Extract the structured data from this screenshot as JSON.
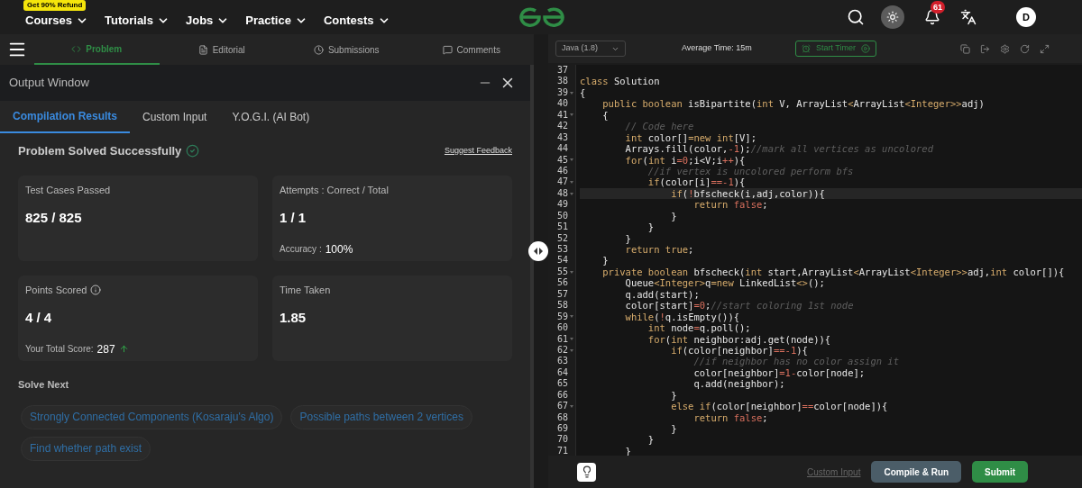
{
  "nav": {
    "promo_badge": "Get 90% Refund",
    "menus": [
      "Courses",
      "Tutorials",
      "Jobs",
      "Practice",
      "Contests"
    ],
    "notification_count": "61",
    "avatar_letter": "D"
  },
  "problem_tabs": [
    {
      "label": "Problem",
      "selected": true
    },
    {
      "label": "Editorial",
      "selected": false
    },
    {
      "label": "Submissions",
      "selected": false
    },
    {
      "label": "Comments",
      "selected": false
    }
  ],
  "output_window": {
    "title": "Output Window",
    "tabs": [
      {
        "label": "Compilation Results",
        "selected": true
      },
      {
        "label": "Custom Input",
        "selected": false
      },
      {
        "label": "Y.O.G.I. (AI Bot)",
        "selected": false
      }
    ],
    "status": "Problem Solved Successfully",
    "feedback_link": "Suggest Feedback",
    "cards": [
      {
        "label": "Test Cases Passed",
        "value": "825 / 825"
      },
      {
        "label": "Attempts : Correct / Total",
        "value": "1 / 1",
        "sub_label": "Accuracy :",
        "sub_value": "100%"
      },
      {
        "label": "Points Scored",
        "info": true,
        "value": "4 / 4",
        "sub_label": "Your Total Score:",
        "sub_value": "287",
        "trend_up": true
      },
      {
        "label": "Time Taken",
        "value": "1.85"
      }
    ],
    "solve_next_title": "Solve Next",
    "solve_next": [
      "Strongly Connected Components (Kosaraju's Algo)",
      "Possible paths between 2 vertices",
      "Find whether path exist"
    ]
  },
  "editor": {
    "language": "Java (1.8)",
    "average_time": "Average Time: 15m",
    "timer_button": "Start Timer",
    "lines": [
      {
        "n": "37"
      },
      {
        "n": "38",
        "code": [
          {
            "kind": "keyword",
            "text": "class"
          },
          {
            "kind": "plain",
            "text": " Solution"
          }
        ]
      },
      {
        "n": "39",
        "fold": true,
        "code": [
          {
            "kind": "plain",
            "text": "{"
          }
        ]
      },
      {
        "n": "40",
        "code": [
          {
            "kind": "keyword",
            "text": "    public boolean"
          },
          {
            "kind": "plain",
            "text": " isBipartite("
          },
          {
            "kind": "keyword",
            "text": "int"
          },
          {
            "kind": "plain",
            "text": " V, ArrayList"
          },
          {
            "kind": "keyword",
            "text": "<"
          },
          {
            "kind": "plain",
            "text": "ArrayList"
          },
          {
            "kind": "keyword",
            "text": "<Integer>>"
          },
          {
            "kind": "plain",
            "text": "adj)"
          }
        ]
      },
      {
        "n": "41",
        "fold": true,
        "code": [
          {
            "kind": "plain",
            "text": "    {"
          }
        ]
      },
      {
        "n": "42",
        "code": [
          {
            "kind": "comment",
            "text": "        // Code here"
          }
        ]
      },
      {
        "n": "43",
        "code": [
          {
            "kind": "keyword",
            "text": "        int"
          },
          {
            "kind": "plain",
            "text": " color[]"
          },
          {
            "kind": "keyword",
            "text": "=new int"
          },
          {
            "kind": "plain",
            "text": "[V];"
          }
        ]
      },
      {
        "n": "44",
        "code": [
          {
            "kind": "plain",
            "text": "        Arrays.fill(color,"
          },
          {
            "kind": "literal",
            "text": "-1"
          },
          {
            "kind": "plain",
            "text": ");"
          },
          {
            "kind": "comment",
            "text": "//mark all vertices as uncolored"
          }
        ]
      },
      {
        "n": "45",
        "fold": true,
        "code": [
          {
            "kind": "keyword",
            "text": "        for"
          },
          {
            "kind": "plain",
            "text": "("
          },
          {
            "kind": "keyword",
            "text": "int"
          },
          {
            "kind": "plain",
            "text": " i"
          },
          {
            "kind": "literal",
            "text": "=0"
          },
          {
            "kind": "plain",
            "text": ";i<V;i"
          },
          {
            "kind": "literal",
            "text": "++"
          },
          {
            "kind": "plain",
            "text": "){"
          }
        ]
      },
      {
        "n": "46",
        "code": [
          {
            "kind": "comment",
            "text": "            //if vertex is uncolored perform bfs"
          }
        ]
      },
      {
        "n": "47",
        "fold": true,
        "code": [
          {
            "kind": "keyword",
            "text": "            if"
          },
          {
            "kind": "plain",
            "text": "(color[i]"
          },
          {
            "kind": "literal",
            "text": "==-1"
          },
          {
            "kind": "plain",
            "text": "){"
          }
        ]
      },
      {
        "n": "48",
        "fold": true,
        "active": true,
        "code": [
          {
            "kind": "keyword",
            "text": "                if"
          },
          {
            "kind": "plain",
            "text": "("
          },
          {
            "kind": "literal",
            "text": "!"
          },
          {
            "kind": "plain",
            "text": "bfscheck(i,adj,color)){"
          }
        ]
      },
      {
        "n": "49",
        "code": [
          {
            "kind": "keyword",
            "text": "                    return"
          },
          {
            "kind": "literal",
            "text": " false"
          },
          {
            "kind": "plain",
            "text": ";"
          }
        ]
      },
      {
        "n": "50",
        "code": [
          {
            "kind": "plain",
            "text": "                }"
          }
        ]
      },
      {
        "n": "51",
        "code": [
          {
            "kind": "plain",
            "text": "            }"
          }
        ]
      },
      {
        "n": "52",
        "code": [
          {
            "kind": "plain",
            "text": "        }"
          }
        ]
      },
      {
        "n": "53",
        "code": [
          {
            "kind": "keyword",
            "text": "        return true"
          },
          {
            "kind": "plain",
            "text": ";"
          }
        ]
      },
      {
        "n": "54",
        "code": [
          {
            "kind": "plain",
            "text": "    }"
          }
        ]
      },
      {
        "n": "55",
        "fold": true,
        "code": [
          {
            "kind": "keyword",
            "text": "    private boolean"
          },
          {
            "kind": "plain",
            "text": " bfscheck("
          },
          {
            "kind": "keyword",
            "text": "int"
          },
          {
            "kind": "plain",
            "text": " start,ArrayList"
          },
          {
            "kind": "keyword",
            "text": "<"
          },
          {
            "kind": "plain",
            "text": "ArrayList"
          },
          {
            "kind": "keyword",
            "text": "<Integer>>"
          },
          {
            "kind": "plain",
            "text": "adj,"
          },
          {
            "kind": "keyword",
            "text": "int"
          },
          {
            "kind": "plain",
            "text": " color[]){"
          }
        ]
      },
      {
        "n": "56",
        "code": [
          {
            "kind": "plain",
            "text": "        Queue"
          },
          {
            "kind": "keyword",
            "text": "<Integer>"
          },
          {
            "kind": "plain",
            "text": "q"
          },
          {
            "kind": "keyword",
            "text": "=new"
          },
          {
            "kind": "plain",
            "text": " LinkedList"
          },
          {
            "kind": "keyword",
            "text": "<>"
          },
          {
            "kind": "plain",
            "text": "();"
          }
        ]
      },
      {
        "n": "57",
        "code": [
          {
            "kind": "plain",
            "text": "        q.add(start);"
          }
        ]
      },
      {
        "n": "58",
        "code": [
          {
            "kind": "plain",
            "text": "        color[start]"
          },
          {
            "kind": "literal",
            "text": "=0"
          },
          {
            "kind": "plain",
            "text": ";"
          },
          {
            "kind": "comment",
            "text": "//start coloring 1st node"
          }
        ]
      },
      {
        "n": "59",
        "fold": true,
        "code": [
          {
            "kind": "keyword",
            "text": "        while"
          },
          {
            "kind": "plain",
            "text": "("
          },
          {
            "kind": "literal",
            "text": "!"
          },
          {
            "kind": "plain",
            "text": "q.isEmpty()){"
          }
        ]
      },
      {
        "n": "60",
        "code": [
          {
            "kind": "keyword",
            "text": "            int"
          },
          {
            "kind": "plain",
            "text": " node"
          },
          {
            "kind": "literal",
            "text": "="
          },
          {
            "kind": "plain",
            "text": "q.poll();"
          }
        ]
      },
      {
        "n": "61",
        "fold": true,
        "code": [
          {
            "kind": "keyword",
            "text": "            for"
          },
          {
            "kind": "plain",
            "text": "("
          },
          {
            "kind": "keyword",
            "text": "int"
          },
          {
            "kind": "plain",
            "text": " neighbor:adj.get(node)){"
          }
        ]
      },
      {
        "n": "62",
        "fold": true,
        "code": [
          {
            "kind": "keyword",
            "text": "                if"
          },
          {
            "kind": "plain",
            "text": "(color[neighbor]"
          },
          {
            "kind": "literal",
            "text": "==-1"
          },
          {
            "kind": "plain",
            "text": "){"
          }
        ]
      },
      {
        "n": "63",
        "code": [
          {
            "kind": "comment",
            "text": "                    //if neighbor has no color assign it"
          }
        ]
      },
      {
        "n": "64",
        "code": [
          {
            "kind": "plain",
            "text": "                    color[neighbor]"
          },
          {
            "kind": "literal",
            "text": "=1-"
          },
          {
            "kind": "plain",
            "text": "color[node];"
          }
        ]
      },
      {
        "n": "65",
        "code": [
          {
            "kind": "plain",
            "text": "                    q.add(neighbor);"
          }
        ]
      },
      {
        "n": "66",
        "code": [
          {
            "kind": "plain",
            "text": "                }"
          }
        ]
      },
      {
        "n": "67",
        "fold": true,
        "code": [
          {
            "kind": "keyword",
            "text": "                else if"
          },
          {
            "kind": "plain",
            "text": "(color[neighbor]"
          },
          {
            "kind": "literal",
            "text": "=="
          },
          {
            "kind": "plain",
            "text": "color[node]){"
          }
        ]
      },
      {
        "n": "68",
        "code": [
          {
            "kind": "keyword",
            "text": "                    return"
          },
          {
            "kind": "literal",
            "text": " false"
          },
          {
            "kind": "plain",
            "text": ";"
          }
        ]
      },
      {
        "n": "69",
        "code": [
          {
            "kind": "plain",
            "text": "                }"
          }
        ]
      },
      {
        "n": "70",
        "code": [
          {
            "kind": "plain",
            "text": "            }"
          }
        ]
      },
      {
        "n": "71",
        "code": [
          {
            "kind": "plain",
            "text": "        }"
          }
        ]
      }
    ],
    "custom_input_link": "Custom Input",
    "compile_button": "Compile & Run",
    "submit_button": "Submit"
  }
}
